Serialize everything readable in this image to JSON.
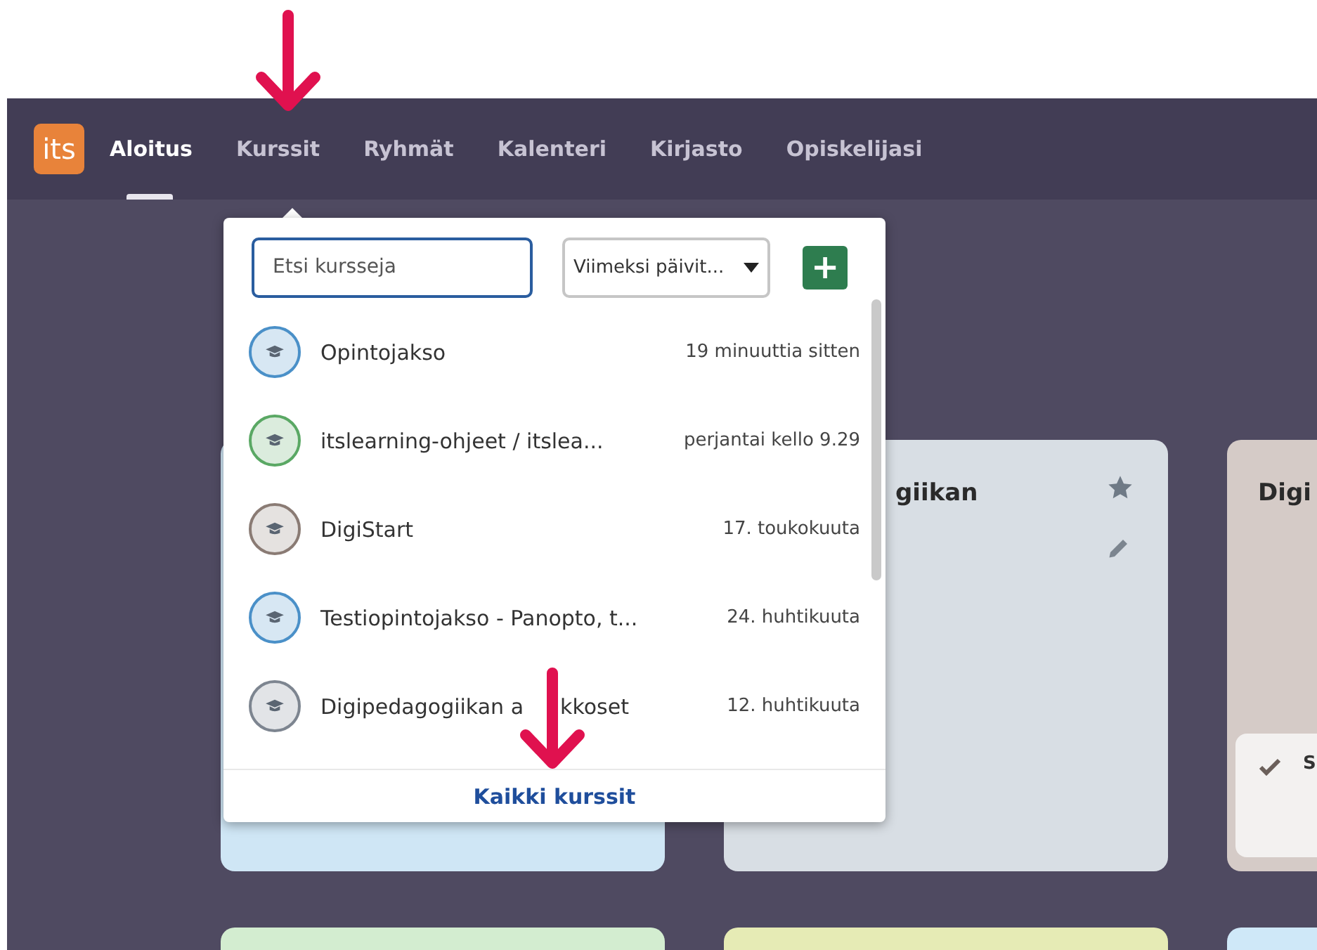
{
  "nav": {
    "logo": "its",
    "items": [
      {
        "label": "Aloitus",
        "selected": true
      },
      {
        "label": "Kurssit",
        "selected": false
      },
      {
        "label": "Ryhmät",
        "selected": false
      },
      {
        "label": "Kalenteri",
        "selected": false
      },
      {
        "label": "Kirjasto",
        "selected": false
      },
      {
        "label": "Opiskelijasi",
        "selected": false
      }
    ]
  },
  "course_menu": {
    "search": {
      "placeholder": "Etsi kursseja"
    },
    "sort": {
      "value": "Viimeksi päivit..."
    },
    "add_button": "+",
    "courses": [
      {
        "name": "Opintojakso",
        "updated": "19 minuuttia sitten",
        "color": "#4a90c8"
      },
      {
        "name": "itslearning-ohjeet / itslea...",
        "updated": "perjantai kello 9.29",
        "color": "#5aa864"
      },
      {
        "name": "DigiStart",
        "updated": "17. toukokuuta",
        "color": "#8a7b74"
      },
      {
        "name": "Testiopintojakso - Panopto, t...",
        "updated": "24. huhtikuuta",
        "color": "#4a90c8"
      },
      {
        "name_parts": [
          "Digipedagogiikan a",
          "kkoset"
        ],
        "updated": "12. huhtikuuta",
        "color": "#7d8590"
      }
    ],
    "all_link": "Kaikki kurssit"
  },
  "cards": [
    {
      "color": "#cfe6f5"
    },
    {
      "title": "giikan",
      "color": "#d8dee4",
      "favorite": true
    },
    {
      "title": "Digi",
      "color": "#d5cbc7",
      "task": "S"
    },
    {
      "color": "#d3edd0"
    },
    {
      "color": "#e6ebb5"
    },
    {
      "color": "#cfe8f8"
    }
  ]
}
